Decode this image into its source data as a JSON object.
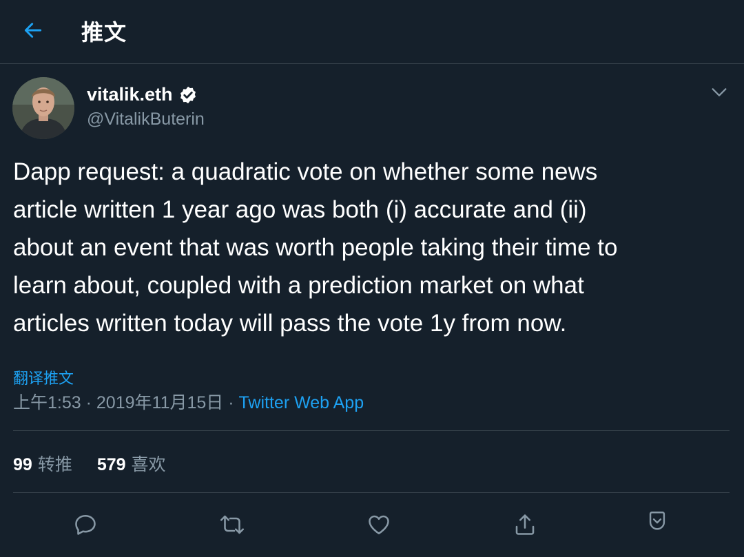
{
  "header": {
    "title": "推文"
  },
  "tweet": {
    "author_name": "vitalik.eth",
    "handle": "@VitalikButerin",
    "text_lines": [
      "Dapp request: a quadratic vote on whether some news",
      "article written 1 year ago was both (i) accurate and (ii)",
      "about an event that was worth people taking their time to",
      "learn about, coupled with a prediction market on what",
      "articles written today will pass the vote 1y from now."
    ],
    "translate_label": "翻译推文",
    "time": "上午1:53",
    "date": "2019年11月15日",
    "separator": "·",
    "source": "Twitter Web App"
  },
  "stats": {
    "retweets_count": "99",
    "retweets_label": "转推",
    "likes_count": "579",
    "likes_label": "喜欢"
  },
  "icons": {
    "back": "arrow-left-icon",
    "verified": "verified-badge-icon",
    "more": "chevron-down-icon",
    "reply": "reply-icon",
    "retweet": "retweet-icon",
    "like": "heart-icon",
    "share": "share-icon",
    "bookmark": "bookmark-icon"
  },
  "colors": {
    "background": "#15202b",
    "accent": "#1da1f2",
    "secondary_text": "#8899a6",
    "divider": "#38444d"
  }
}
